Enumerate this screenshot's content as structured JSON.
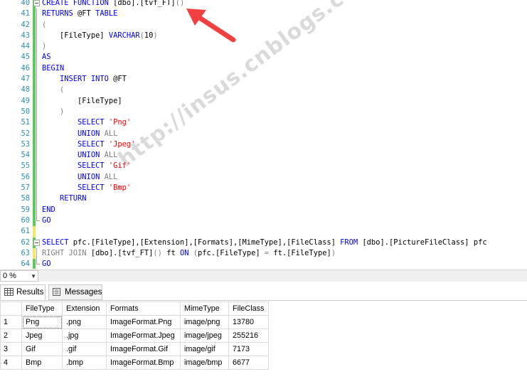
{
  "editor": {
    "lines": [
      {
        "n": "40",
        "g": "green",
        "f": "box",
        "t": [
          [
            "kw",
            "CREATE FUNCTION "
          ],
          [
            "",
            "[dbo].[tvf_FT]"
          ],
          [
            "gray",
            "()"
          ]
        ]
      },
      {
        "n": "41",
        "g": "green",
        "f": "line",
        "t": [
          [
            "kw",
            "RETURNS "
          ],
          [
            "",
            "@FT "
          ],
          [
            "kw",
            "TABLE"
          ]
        ]
      },
      {
        "n": "42",
        "g": "green",
        "f": "line",
        "t": [
          [
            "gray",
            "("
          ]
        ]
      },
      {
        "n": "43",
        "g": "green",
        "f": "line",
        "t": [
          [
            "",
            "    [FileType] "
          ],
          [
            "kw",
            "VARCHAR"
          ],
          [
            "gray",
            "("
          ],
          [
            "",
            "10"
          ],
          [
            "gray",
            ")"
          ]
        ]
      },
      {
        "n": "44",
        "g": "green",
        "f": "line",
        "t": [
          [
            "gray",
            ")"
          ]
        ]
      },
      {
        "n": "45",
        "g": "green",
        "f": "line",
        "t": [
          [
            "kw",
            "AS"
          ]
        ]
      },
      {
        "n": "46",
        "g": "green",
        "f": "line",
        "t": [
          [
            "kw",
            "BEGIN"
          ]
        ]
      },
      {
        "n": "47",
        "g": "green",
        "f": "line",
        "t": [
          [
            "",
            "    "
          ],
          [
            "kw",
            "INSERT INTO "
          ],
          [
            "",
            "@FT"
          ]
        ]
      },
      {
        "n": "48",
        "g": "green",
        "f": "line",
        "t": [
          [
            "gray",
            "    ("
          ]
        ]
      },
      {
        "n": "49",
        "g": "green",
        "f": "line",
        "t": [
          [
            "",
            "        [FileType]"
          ]
        ]
      },
      {
        "n": "50",
        "g": "green",
        "f": "line",
        "t": [
          [
            "gray",
            "    )"
          ]
        ]
      },
      {
        "n": "51",
        "g": "green",
        "f": "line",
        "t": [
          [
            "",
            "        "
          ],
          [
            "kw",
            "SELECT "
          ],
          [
            "str",
            "'Png'"
          ]
        ]
      },
      {
        "n": "52",
        "g": "green",
        "f": "line",
        "t": [
          [
            "",
            "        "
          ],
          [
            "kw",
            "UNION "
          ],
          [
            "gray",
            "ALL"
          ]
        ]
      },
      {
        "n": "53",
        "g": "green",
        "f": "line",
        "t": [
          [
            "",
            "        "
          ],
          [
            "kw",
            "SELECT "
          ],
          [
            "str",
            "'Jpeg'"
          ]
        ]
      },
      {
        "n": "54",
        "g": "green",
        "f": "line",
        "t": [
          [
            "",
            "        "
          ],
          [
            "kw",
            "UNION "
          ],
          [
            "gray",
            "ALL"
          ]
        ]
      },
      {
        "n": "55",
        "g": "green",
        "f": "line",
        "t": [
          [
            "",
            "        "
          ],
          [
            "kw",
            "SELECT "
          ],
          [
            "str",
            "'Gif'"
          ]
        ]
      },
      {
        "n": "56",
        "g": "green",
        "f": "line",
        "t": [
          [
            "",
            "        "
          ],
          [
            "kw",
            "UNION "
          ],
          [
            "gray",
            "ALL"
          ]
        ]
      },
      {
        "n": "57",
        "g": "green",
        "f": "line",
        "t": [
          [
            "",
            "        "
          ],
          [
            "kw",
            "SELECT "
          ],
          [
            "str",
            "'Bmp'"
          ]
        ]
      },
      {
        "n": "58",
        "g": "green",
        "f": "line",
        "t": [
          [
            "",
            "    "
          ],
          [
            "kw",
            "RETURN"
          ]
        ]
      },
      {
        "n": "59",
        "g": "green",
        "f": "line",
        "t": [
          [
            "kw",
            "END"
          ]
        ]
      },
      {
        "n": "60",
        "g": "green",
        "f": "end",
        "t": [
          [
            "kw",
            "GO"
          ]
        ]
      },
      {
        "n": "61",
        "g": "yellow",
        "f": "",
        "t": []
      },
      {
        "n": "62",
        "g": "green",
        "f": "box",
        "t": [
          [
            "kw",
            "SELECT "
          ],
          [
            "",
            "pfc.[FileType],[Extension],[Formats],[MimeType],[FileClass] "
          ],
          [
            "kw",
            "FROM "
          ],
          [
            "",
            "[dbo].[PictureFileClass] pfc"
          ]
        ]
      },
      {
        "n": "63",
        "g": "yellow",
        "f": "line",
        "t": [
          [
            "gray",
            "RIGHT JOIN "
          ],
          [
            "",
            "[dbo].[tvf_FT]"
          ],
          [
            "gray",
            "() "
          ],
          [
            "",
            "ft "
          ],
          [
            "kw",
            "ON "
          ],
          [
            "gray",
            "("
          ],
          [
            "",
            "pfc.[FileType] "
          ],
          [
            "gray",
            "= "
          ],
          [
            "",
            "ft.[FileType]"
          ],
          [
            "gray",
            ")"
          ]
        ]
      },
      {
        "n": "64",
        "g": "green",
        "f": "end",
        "t": [
          [
            "kw",
            "GO"
          ]
        ]
      }
    ],
    "watermark": "http://insus.cnblogs.com"
  },
  "zoom": {
    "value": "0 %"
  },
  "tabs": [
    {
      "label": "Results",
      "icon": "grid-icon"
    },
    {
      "label": "Messages",
      "icon": "messages-icon"
    }
  ],
  "grid": {
    "columns": [
      "FileType",
      "Extension",
      "Formats",
      "MimeType",
      "FileClass"
    ],
    "rows": [
      [
        "1",
        "Png",
        ".png",
        "ImageFormat.Png",
        "image/png",
        "13780"
      ],
      [
        "2",
        "Jpeg",
        ".jpg",
        "ImageFormat.Jpeg",
        "image/jpeg",
        "255216"
      ],
      [
        "3",
        "Gif",
        ".gif",
        "ImageFormat.Gif",
        "image/gif",
        "7173"
      ],
      [
        "4",
        "Bmp",
        ".bmp",
        "ImageFormat.Bmp",
        "image/bmp",
        "6677"
      ]
    ]
  },
  "colors": {
    "keyword": "#0000ff",
    "string": "#ff0000",
    "operator": "#808080",
    "line_number": "#2b91af",
    "arrow": "#f04040"
  }
}
